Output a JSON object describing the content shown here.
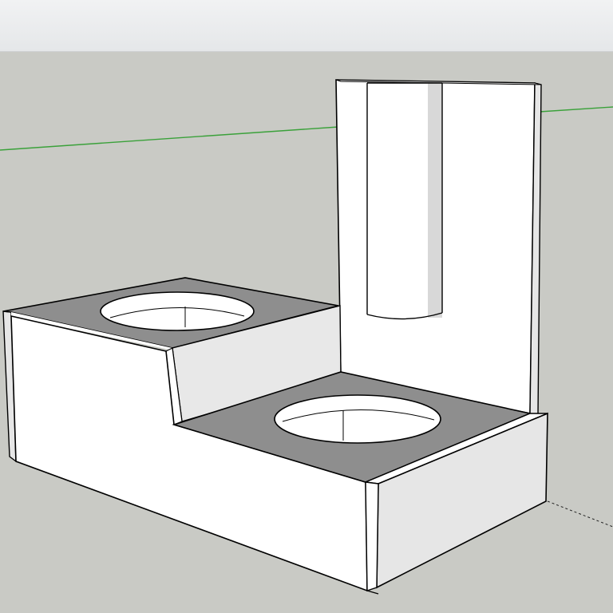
{
  "app": {
    "toolbar": {},
    "viewport": {
      "background_color": "#c9cac5",
      "axes": {
        "green_axis_color": "#3aa13a",
        "red_axis_color": "#222222",
        "dashed_axis_style": "dashed"
      },
      "model": {
        "face_color": "#ffffff",
        "side_face_color": "#e6e6e6",
        "top_face_color": "#8e8e8e",
        "edge_color": "#000000"
      }
    }
  }
}
